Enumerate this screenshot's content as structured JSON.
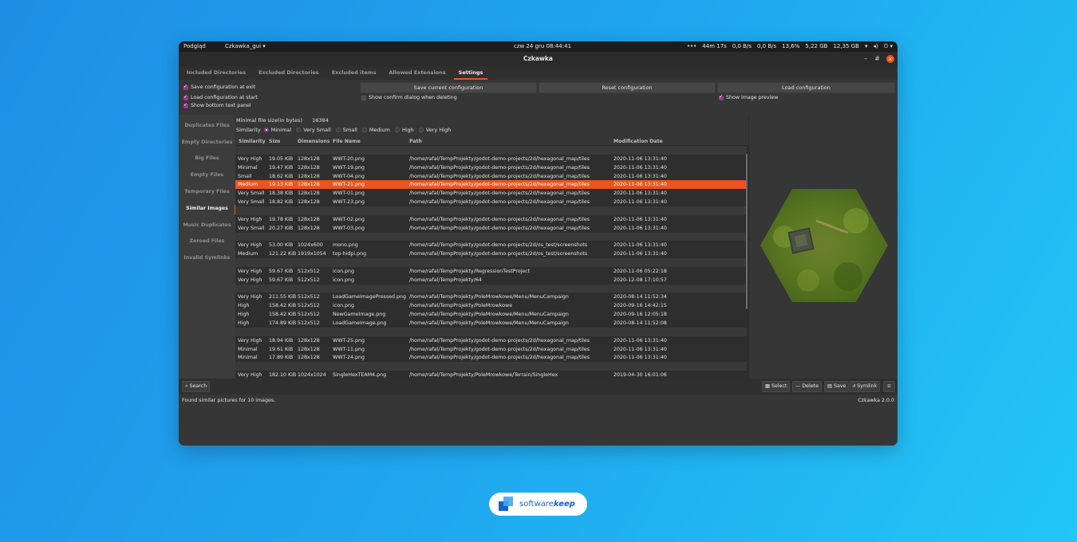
{
  "system_bar": {
    "app_menu": "Podgląd",
    "app_name": "Czkawka_gui ▾",
    "clock": "czw 24 gru 08:44:41",
    "indicators": [
      "•••",
      "44m 17s",
      "0,0 B/s",
      "0,0 B/s",
      "13,6%",
      "5,22 GB",
      "12,35 GB"
    ]
  },
  "window": {
    "title": "Czkawka",
    "minimize": "–",
    "maximize": "#",
    "close": "x"
  },
  "tabs": [
    {
      "label": "Included Directories"
    },
    {
      "label": "Excluded Directories"
    },
    {
      "label": "Excluded items"
    },
    {
      "label": "Allowed Extensions"
    },
    {
      "label": "Settings"
    }
  ],
  "settings": {
    "save_at_exit": "Save configuration at exit",
    "load_at_start": "Load configuration at start",
    "show_bottom_panel": "Show bottom text panel",
    "save_button": "Save current configuration",
    "reset_button": "Reset configuration",
    "load_button": "Load configuration",
    "show_confirm": "Show confirm dialog when deleting",
    "show_preview": "Show image preview"
  },
  "sidebar": {
    "items": [
      {
        "label": "Duplicates Files"
      },
      {
        "label": "Empty Directories"
      },
      {
        "label": "Big Files"
      },
      {
        "label": "Empty Files"
      },
      {
        "label": "Temporary Files"
      },
      {
        "label": "Similar Images"
      },
      {
        "label": "Music Duplicates"
      },
      {
        "label": "Zeroed Files"
      },
      {
        "label": "Invalid Symlinks"
      }
    ]
  },
  "filters": {
    "min_size_label": "Minimal file size(in bytes)",
    "min_size_value": "16384",
    "similarity_label": "Similarity",
    "options": [
      "Minimal",
      "Very Small",
      "Small",
      "Medium",
      "High",
      "Very High"
    ],
    "selected": "Minimal"
  },
  "table": {
    "columns": [
      "Similarity",
      "Size",
      "Dimensions",
      "File Name",
      "Path",
      "Modification Date"
    ],
    "rows": [
      {
        "sep": true
      },
      {
        "sim": "Very High",
        "size": "19.05 KiB",
        "dim": "128x128",
        "name": "WWT-20.png",
        "path": "/home/rafal/TempProjekty/godot-demo-projects/2d/hexagonal_map/tiles",
        "date": "2020-11-06 13:31:40"
      },
      {
        "sim": "Minimal",
        "size": "19.47 KiB",
        "dim": "128x128",
        "name": "WWT-19.png",
        "path": "/home/rafal/TempProjekty/godot-demo-projects/2d/hexagonal_map/tiles",
        "date": "2020-11-06 13:31:40"
      },
      {
        "sim": "Small",
        "size": "18.62 KiB",
        "dim": "128x128",
        "name": "WWT-04.png",
        "path": "/home/rafal/TempProjekty/godot-demo-projects/2d/hexagonal_map/tiles",
        "date": "2020-11-06 13:31:40"
      },
      {
        "sim": "Medium",
        "size": "19.13 KiB",
        "dim": "128x128",
        "name": "WWT-21.png",
        "path": "/home/rafal/TempProjekty/godot-demo-projects/2d/hexagonal_map/tiles",
        "date": "2020-11-06 13:31:40",
        "selected": true
      },
      {
        "sim": "Very Small",
        "size": "18.38 KiB",
        "dim": "128x128",
        "name": "WWT-01.png",
        "path": "/home/rafal/TempProjekty/godot-demo-projects/2d/hexagonal_map/tiles",
        "date": "2020-11-06 13:31:40"
      },
      {
        "sim": "Very Small",
        "size": "18.82 KiB",
        "dim": "128x128",
        "name": "WWT-23.png",
        "path": "/home/rafal/TempProjekty/godot-demo-projects/2d/hexagonal_map/tiles",
        "date": "2020-11-06 13:31:40"
      },
      {
        "sep": true
      },
      {
        "sim": "Very High",
        "size": "19.78 KiB",
        "dim": "128x128",
        "name": "WWT-02.png",
        "path": "/home/rafal/TempProjekty/godot-demo-projects/2d/hexagonal_map/tiles",
        "date": "2020-11-06 13:31:40"
      },
      {
        "sim": "Very Small",
        "size": "20.27 KiB",
        "dim": "128x128",
        "name": "WWT-03.png",
        "path": "/home/rafal/TempProjekty/godot-demo-projects/2d/hexagonal_map/tiles",
        "date": "2020-11-06 13:31:40"
      },
      {
        "sep": true
      },
      {
        "sim": "Very High",
        "size": "53.00 KiB",
        "dim": "1024x600",
        "name": "mono.png",
        "path": "/home/rafal/TempProjekty/godot-demo-projects/2d/os_test/screenshots",
        "date": "2020-11-06 13:31:40"
      },
      {
        "sim": "Medium",
        "size": "121.22 KiB",
        "dim": "1919x1054",
        "name": "top-hidpi.png",
        "path": "/home/rafal/TempProjekty/godot-demo-projects/2d/os_test/screenshots",
        "date": "2020-11-06 13:31:40"
      },
      {
        "sep": true
      },
      {
        "sim": "Very High",
        "size": "59.67 KiB",
        "dim": "512x512",
        "name": "icon.png",
        "path": "/home/rafal/TempProjekty/RegressionTestProject",
        "date": "2020-11-06 05:22:18"
      },
      {
        "sim": "Very High",
        "size": "59.67 KiB",
        "dim": "512x512",
        "name": "icon.png",
        "path": "/home/rafal/TempProjekty/64",
        "date": "2020-12-08 17:10:57"
      },
      {
        "sep": true
      },
      {
        "sim": "Very High",
        "size": "211.55 KiB",
        "dim": "512x512",
        "name": "LoadGameImagePressed.png",
        "path": "/home/rafal/TempProjekty/PoleMrowkowe/Menu/MenuCampaign",
        "date": "2020-08-14 11:52:34"
      },
      {
        "sim": "High",
        "size": "158.42 KiB",
        "dim": "512x512",
        "name": "icon.png",
        "path": "/home/rafal/TempProjekty/PoleMrowkowe",
        "date": "2020-09-16 14:42:15"
      },
      {
        "sim": "High",
        "size": "158.42 KiB",
        "dim": "512x512",
        "name": "NewGameImage.png",
        "path": "/home/rafal/TempProjekty/PoleMrowkowe/Menu/MenuCampaign",
        "date": "2020-09-16 12:05:18"
      },
      {
        "sim": "High",
        "size": "174.89 KiB",
        "dim": "512x512",
        "name": "LoadGameImage.png",
        "path": "/home/rafal/TempProjekty/PoleMrowkowe/Menu/MenuCampaign",
        "date": "2020-08-14 11:52:08"
      },
      {
        "sep": true
      },
      {
        "sim": "Very High",
        "size": "18.94 KiB",
        "dim": "128x128",
        "name": "WWT-25.png",
        "path": "/home/rafal/TempProjekty/godot-demo-projects/2d/hexagonal_map/tiles",
        "date": "2020-11-06 13:31:40"
      },
      {
        "sim": "Minimal",
        "size": "19.61 KiB",
        "dim": "128x128",
        "name": "WWT-11.png",
        "path": "/home/rafal/TempProjekty/godot-demo-projects/2d/hexagonal_map/tiles",
        "date": "2020-11-06 13:31:40"
      },
      {
        "sim": "Minimal",
        "size": "17.89 KiB",
        "dim": "128x128",
        "name": "WWT-24.png",
        "path": "/home/rafal/TempProjekty/godot-demo-projects/2d/hexagonal_map/tiles",
        "date": "2020-11-06 13:31:40"
      },
      {
        "sep": true
      },
      {
        "sim": "Very High",
        "size": "182.10 KiB",
        "dim": "1024x1024",
        "name": "SingleHexTEAM4.png",
        "path": "/home/rafal/TempProjekty/PoleMrowkowe/Terrain/SingleHex",
        "date": "2019-04-30 16:01:06"
      }
    ]
  },
  "bottom": {
    "search": "Search",
    "select": "Select",
    "delete": "Delete",
    "save": "Save",
    "symlink": "Symlink",
    "menu_icon": "hamburger-icon"
  },
  "status": {
    "message": "Found similar pictures for 10 images.",
    "version": "Czkawka 2.0.0"
  },
  "badge": {
    "word1": "software",
    "word2": "keep"
  },
  "colors": {
    "accent": "#e95420",
    "checkbox": "#8e3c86"
  }
}
